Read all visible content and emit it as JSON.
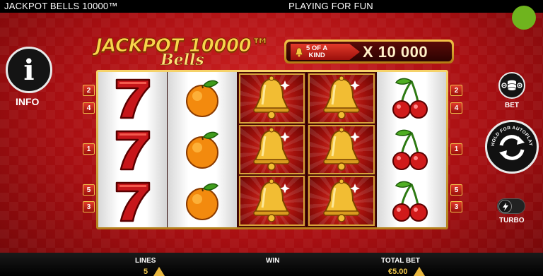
{
  "topbar": {
    "game_title": "JACKPOT BELLS 10000™",
    "mode": "PLAYING FOR FUN"
  },
  "status_indicator": {
    "color": "#6fb41e"
  },
  "info": {
    "glyph": "i",
    "label": "INFO"
  },
  "logo": {
    "line1": "JACKPOT 10000™",
    "line2": "Bells"
  },
  "kind_banner": {
    "tag_line1": "5 OF A",
    "tag_line2": "KIND",
    "multiplier": "X 10 000"
  },
  "reels": [
    {
      "symbols": [
        "seven",
        "seven",
        "seven"
      ]
    },
    {
      "symbols": [
        "orange",
        "orange",
        "orange"
      ]
    },
    {
      "symbols": [
        "bell",
        "bell",
        "bell"
      ]
    },
    {
      "symbols": [
        "bell",
        "bell",
        "bell"
      ]
    },
    {
      "symbols": [
        "cherry",
        "cherry",
        "cherry"
      ]
    }
  ],
  "line_markers": {
    "left": [
      "2",
      "4",
      "1",
      "5",
      "3"
    ],
    "right": [
      "2",
      "4",
      "1",
      "5",
      "3"
    ]
  },
  "controls": {
    "bet_label": "BET",
    "autoplay_hint": "HOLD FOR AUTOPLAY",
    "turbo_label": "TURBO"
  },
  "bottombar": {
    "lines_label": "LINES",
    "lines_value": "5",
    "win_label": "WIN",
    "total_bet_label": "TOTAL BET",
    "total_bet_value": "€5.00"
  },
  "colors": {
    "background": "#b3141a",
    "gold": "#f4c54a",
    "accent_value": "#f2c94c"
  }
}
